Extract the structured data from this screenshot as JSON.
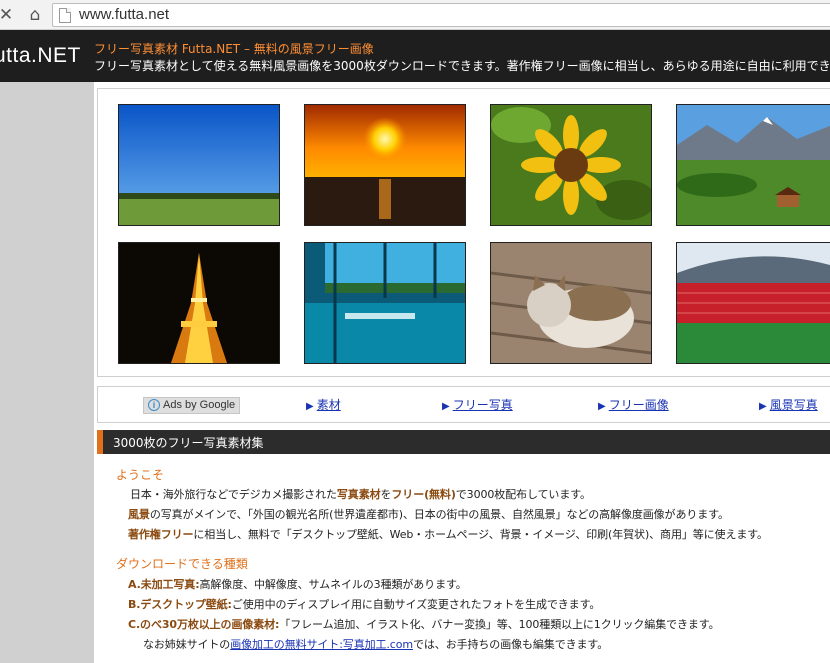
{
  "browser": {
    "url": "www.futta.net",
    "close_glyph": "✕",
    "home_glyph": "⌂"
  },
  "header": {
    "logo": "utta.NET",
    "title": "フリー写真素材 Futta.NET – 無料の風景フリー画像",
    "subtitle": "フリー写真素材として使える無料風景画像を3000枚ダウンロードできます。著作権フリー画像に相当し、あらゆる用途に自由に利用できます"
  },
  "gallery": {
    "photos": [
      {
        "subject": "blue sky over green meadow"
      },
      {
        "subject": "sunset over the sea"
      },
      {
        "subject": "sunflower"
      },
      {
        "subject": "alpine village with mountains"
      },
      {
        "subject": "Tokyo Tower at night"
      },
      {
        "subject": "glass hall with bench and sea view"
      },
      {
        "subject": "tabby cat on wooden bench"
      },
      {
        "subject": "stadium with red seats"
      }
    ]
  },
  "ads": {
    "badge": "Ads by Google",
    "badge_icon": "i",
    "links": [
      "素材",
      "フリー写真",
      "フリー画像",
      "風景写真"
    ],
    "arrow": "▶"
  },
  "section": {
    "heading": "3000枚のフリー写真素材集"
  },
  "welcome": {
    "heading": "ようこそ",
    "line1": {
      "a": "日本・海外旅行などでデジカメ撮影された",
      "b1": "写真素材",
      "c": "を",
      "b2": "フリー(無料)",
      "d": "で3000枚配布しています。"
    },
    "line2": {
      "b1": "風景",
      "a": "の写真がメインで、「外国の観光名所(世界遺産都市)、日本の街中の風景、自然風景」などの高解像度画像があります。"
    },
    "line3": {
      "b1": "著作権フリー",
      "a": "に相当し、無料で「デスクトップ壁紙、Web・ホームページ、背景・イメージ、印刷(年賀状)、商用」等に使えます。"
    }
  },
  "download": {
    "heading": "ダウンロードできる種類",
    "itemA": {
      "label": "A.未加工写真:",
      "text": "高解像度、中解像度、サムネイルの3種類があります。"
    },
    "itemB": {
      "label": "B.デスクトップ壁紙:",
      "text": "ご使用中のディスプレイ用に自動サイズ変更されたフォトを生成できます。"
    },
    "itemC": {
      "label": "C.のべ30万枚以上の画像素材:",
      "text": "「フレーム追加、イラスト化、バナー変換」等、100種類以上に1クリック編集できます。"
    },
    "note": {
      "a": "なお姉妹サイトの",
      "link": "画像加工の無料サイト:写真加工.com",
      "b": "では、お手持ちの画像も編集できます。"
    }
  },
  "colors": {
    "accent": "#e0701c",
    "header_bg": "#1e1e1e",
    "link": "#1a33b3",
    "bold_text": "#8a4a10"
  }
}
